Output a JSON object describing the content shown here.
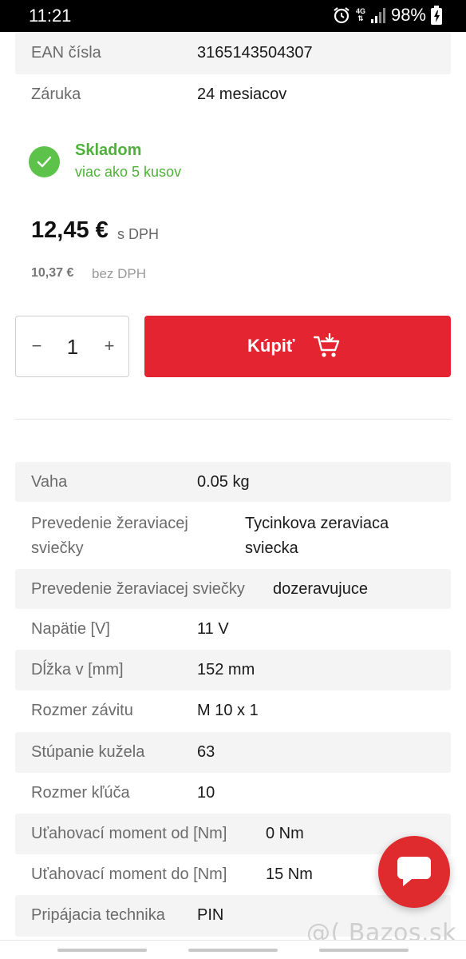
{
  "status_bar": {
    "time": "11:21",
    "network": "4G",
    "battery": "98%"
  },
  "top_specs": [
    {
      "label": "EAN čísla",
      "value": "3165143504307"
    },
    {
      "label": "Záruka",
      "value": "24 mesiacov"
    }
  ],
  "stock": {
    "title": "Skladom",
    "subtitle": "viac ako 5 kusov"
  },
  "price": {
    "gross": "12,45 €",
    "gross_suffix": "s DPH",
    "net": "10,37 €",
    "net_suffix": "bez DPH"
  },
  "quantity": {
    "minus": "−",
    "value": "1",
    "plus": "+"
  },
  "buy_button": {
    "label": "Kúpiť"
  },
  "specs": [
    {
      "label": "Vaha",
      "value": "0.05 kg"
    },
    {
      "label": "Prevedenie žeraviacej sviečky",
      "value": "Tycinkova zeraviaca sviecka"
    },
    {
      "label": "Prevedenie žeraviacej sviečky",
      "value": "dozeravujuce"
    },
    {
      "label": "Napätie [V]",
      "value": "11 V"
    },
    {
      "label": "Dĺžka v [mm]",
      "value": "152 mm"
    },
    {
      "label": "Rozmer závitu",
      "value": "M 10 x 1"
    },
    {
      "label": "Stúpanie kužela",
      "value": "63"
    },
    {
      "label": "Rozmer kľúča",
      "value": "10"
    },
    {
      "label": "Uťahovací moment od [Nm]",
      "value": "0 Nm"
    },
    {
      "label": "Uťahovací moment do [Nm]",
      "value": "15 Nm"
    },
    {
      "label": "Pripájacia technika",
      "value": "PIN"
    }
  ],
  "watermark": "@( Bazos.sk",
  "colors": {
    "accent_red": "#e42531",
    "stock_green": "#5dc24a",
    "row_shade": "#f4f4f4"
  }
}
